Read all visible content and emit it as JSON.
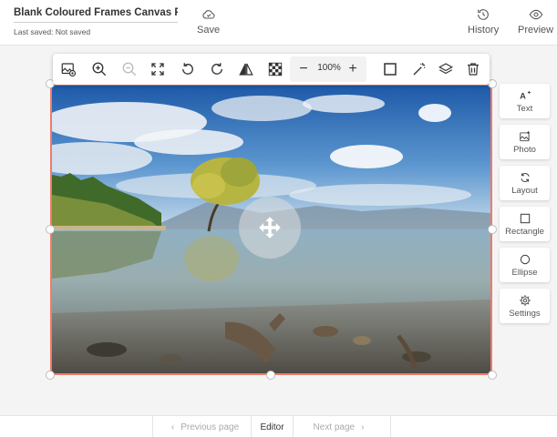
{
  "header": {
    "title": "Blank Coloured Frames Canvas P...",
    "save_status": "Last saved:  Not saved",
    "save_label": "Save",
    "history_label": "History",
    "preview_label": "Preview"
  },
  "toolbar": {
    "zoom_level": "100%",
    "zoom_minus": "−",
    "zoom_plus": "+",
    "icons": [
      "replace-image-icon",
      "zoom-in-icon",
      "zoom-out-icon",
      "fit-screen-icon",
      "rotate-left-icon",
      "rotate-right-icon",
      "flip-icon",
      "transparency-icon",
      "border-icon",
      "magic-wand-icon",
      "layers-icon",
      "delete-icon"
    ]
  },
  "side_tools": [
    {
      "label": "Text",
      "icon": "text-add-icon"
    },
    {
      "label": "Photo",
      "icon": "photo-add-icon"
    },
    {
      "label": "Layout",
      "icon": "layout-icon"
    },
    {
      "label": "Rectangle",
      "icon": "rectangle-icon"
    },
    {
      "label": "Ellipse",
      "icon": "ellipse-icon"
    },
    {
      "label": "Settings",
      "icon": "gear-icon"
    }
  ],
  "footer": {
    "prev_label": "Previous page",
    "editor_label": "Editor",
    "next_label": "Next page"
  },
  "colors": {
    "frame": "#f07a6b",
    "icon": "#333333"
  }
}
